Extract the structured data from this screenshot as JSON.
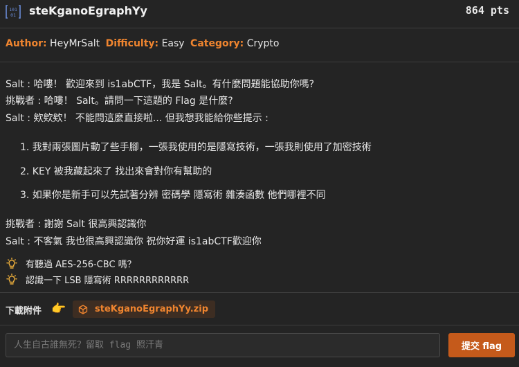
{
  "header": {
    "title": "steKganoEgraphYy",
    "points": "864 pts"
  },
  "meta": {
    "author_key": "Author:",
    "author_value": "HeyMrSalt",
    "difficulty_key": "Difficulty:",
    "difficulty_value": "Easy",
    "category_key": "Category:",
    "category_value": "Crypto"
  },
  "description": {
    "intro_lines": [
      "Salt : 哈嘍！ 歡迎來到 is1abCTF，我是 Salt。有什麼問題能協助你嗎?",
      "挑戰者 : 哈嘍！ Salt。請問一下這題的 Flag 是什麼?",
      "Salt : 欸欸欸！ 不能問這麼直接啦... 但我想我能給你些提示 :"
    ],
    "hints_list": [
      "1. 我對兩張圖片動了些手腳，一張我使用的是隱寫技術，一張我則使用了加密技術",
      "2. KEY 被我藏起來了 找出來會對你有幫助的",
      "3. 如果你是新手可以先試著分辨 密碼學 隱寫術 雜湊函數 他們哪裡不同"
    ],
    "outro_lines": [
      "挑戰者 : 謝謝 Salt 很高興認識你",
      "Salt : 不客氣 我也很高興認識你 祝你好運 is1abCTF歡迎你"
    ]
  },
  "hints": [
    {
      "icon": "lightbulb-icon",
      "text": "有聽過 AES-256-CBC 嗎？"
    },
    {
      "icon": "lightbulb-icon",
      "text": "認識一下 LSB 隱寫術 RRRRRRRRRRRR"
    }
  ],
  "attachments": {
    "label": "下載附件",
    "pointer_icon": "pointing-hand-icon",
    "file_icon": "package-icon",
    "file_name": "steKganoEgraphYy.zip"
  },
  "flag_form": {
    "placeholder": "人生自古誰無死？留取 flag 照汗青",
    "value": "",
    "submit_label": "提交 flag"
  },
  "colors": {
    "background": "#242424",
    "accent": "#f0852f",
    "submit": "#c55a1b",
    "chip": "#3d2d22",
    "hint_icon": "#f5b43c"
  }
}
